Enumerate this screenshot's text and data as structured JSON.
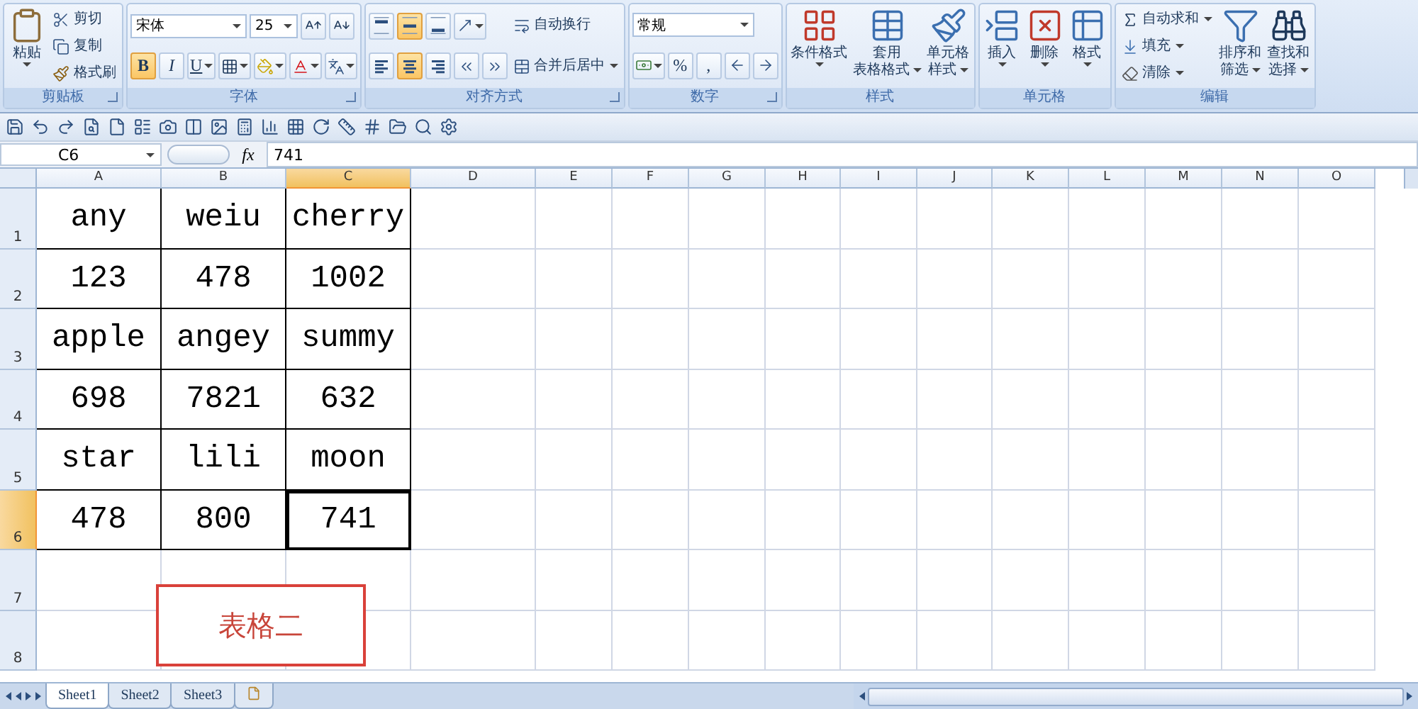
{
  "ribbon": {
    "groups": [
      {
        "title": "剪贴板",
        "launcher": true,
        "columns": [
          {
            "kind": "large",
            "button": {
              "kind": "paste",
              "lines": [
                "粘贴"
              ],
              "dropdown": true
            }
          },
          {
            "kind": "stack",
            "rows": [
              [
                {
                  "kind": "cut",
                  "label": "剪切"
                }
              ],
              [
                {
                  "kind": "copy",
                  "label": "复制"
                }
              ],
              [
                {
                  "kind": "painter",
                  "label": "格式刷"
                }
              ]
            ]
          }
        ]
      },
      {
        "title": "字体",
        "launcher": true,
        "columns": [
          {
            "kind": "stack",
            "rows": [
              [
                {
                  "kind": "font",
                  "value": "宋体"
                },
                {
                  "kind": "size",
                  "value": "25"
                },
                {
                  "kind": "grow"
                },
                {
                  "kind": "shrink"
                }
              ],
              [
                {
                  "kind": "bold",
                  "text": "B",
                  "selected": true
                },
                {
                  "kind": "italic",
                  "text": "I",
                  "selected": false
                },
                {
                  "kind": "underline",
                  "text": "U",
                  "selected": false,
                  "dropdown": true
                },
                {
                  "kind": "border",
                  "dropdown": true
                },
                {
                  "kind": "fill",
                  "dropdown": true
                },
                {
                  "kind": "fontcolor",
                  "dropdown": true
                },
                {
                  "kind": "phonetic",
                  "dropdown": true
                }
              ]
            ]
          }
        ]
      },
      {
        "title": "对齐方式",
        "launcher": true,
        "columns": [
          {
            "kind": "stack",
            "rows": [
              [
                {
                  "kind": "aligntop",
                  "selected": false
                },
                {
                  "kind": "alignmiddle",
                  "selected": true
                },
                {
                  "kind": "alignbottom",
                  "selected": false
                },
                {
                  "kind": "orient",
                  "dropdown": true
                }
              ],
              [
                {
                  "kind": "alignleft",
                  "selected": false
                },
                {
                  "kind": "aligncenter",
                  "selected": true
                },
                {
                  "kind": "alignright",
                  "selected": false
                },
                {
                  "kind": "outdent"
                },
                {
                  "kind": "indent"
                }
              ]
            ]
          },
          {
            "kind": "stack",
            "rows": [
              [
                {
                  "kind": "wrap",
                  "label": "自动换行"
                }
              ],
              [
                {
                  "kind": "merge",
                  "label": "合并后居中",
                  "dropdown": true
                }
              ]
            ]
          }
        ]
      },
      {
        "title": "数字",
        "launcher": true,
        "columns": [
          {
            "kind": "stack",
            "rows": [
              [
                {
                  "kind": "format",
                  "value": "常规"
                }
              ],
              [
                {
                  "kind": "currency",
                  "dropdown": true
                },
                {
                  "kind": "percent",
                  "text": "%"
                },
                {
                  "kind": "comma",
                  "text": ","
                },
                {
                  "kind": "decinc"
                },
                {
                  "kind": "decdec"
                }
              ]
            ]
          }
        ]
      },
      {
        "title": "样式",
        "launcher": false,
        "columns": [
          {
            "kind": "large",
            "button": {
              "kind": "conditional",
              "lines": [
                "条件格式"
              ],
              "dropdown": true
            }
          },
          {
            "kind": "large",
            "button": {
              "kind": "tablestyle",
              "lines": [
                "套用",
                "表格格式"
              ],
              "dropdown": true
            }
          },
          {
            "kind": "large",
            "button": {
              "kind": "cellstyle",
              "lines": [
                "单元格",
                "样式"
              ],
              "dropdown": true
            }
          }
        ]
      },
      {
        "title": "单元格",
        "launcher": false,
        "columns": [
          {
            "kind": "large",
            "button": {
              "kind": "insert",
              "lines": [
                "插入"
              ],
              "dropdown": true
            }
          },
          {
            "kind": "large",
            "button": {
              "kind": "delete",
              "lines": [
                "删除"
              ],
              "dropdown": true
            }
          },
          {
            "kind": "large",
            "button": {
              "kind": "cellformat",
              "lines": [
                "格式"
              ],
              "dropdown": true
            }
          }
        ]
      },
      {
        "title": "编辑",
        "launcher": false,
        "columns": [
          {
            "kind": "stack",
            "rows": [
              [
                {
                  "kind": "autosum",
                  "label": "自动求和",
                  "dropdown": true
                }
              ],
              [
                {
                  "kind": "filldown",
                  "label": "填充",
                  "dropdown": true
                }
              ],
              [
                {
                  "kind": "clear",
                  "label": "清除",
                  "dropdown": true
                }
              ]
            ]
          },
          {
            "kind": "large",
            "button": {
              "kind": "sort",
              "lines": [
                "排序和",
                "筛选"
              ],
              "dropdown": true
            }
          },
          {
            "kind": "large",
            "button": {
              "kind": "find",
              "lines": [
                "查找和",
                "选择"
              ],
              "dropdown": true
            }
          }
        ]
      }
    ]
  },
  "formula_bar": {
    "name_box": "C6",
    "function_label": "fx",
    "value": "741"
  },
  "grid": {
    "bordered": true,
    "columns": [
      {
        "label": "A",
        "selected": false
      },
      {
        "label": "B",
        "selected": false
      },
      {
        "label": "C",
        "selected": true
      },
      {
        "label": "D",
        "selected": false
      },
      {
        "label": "E",
        "selected": false
      },
      {
        "label": "F",
        "selected": false
      },
      {
        "label": "G",
        "selected": false
      },
      {
        "label": "H",
        "selected": false
      },
      {
        "label": "I",
        "selected": false
      },
      {
        "label": "J",
        "selected": false
      },
      {
        "label": "K",
        "selected": false
      },
      {
        "label": "L",
        "selected": false
      },
      {
        "label": "M",
        "selected": false
      },
      {
        "label": "N",
        "selected": false
      },
      {
        "label": "O",
        "selected": false
      }
    ],
    "rows": [
      {
        "label": "1",
        "selected": false,
        "cells": [
          "any",
          "weiu",
          "cherry"
        ]
      },
      {
        "label": "2",
        "selected": false,
        "cells": [
          "123",
          "478",
          "1002"
        ]
      },
      {
        "label": "3",
        "selected": false,
        "cells": [
          "apple",
          "angey",
          "summy"
        ]
      },
      {
        "label": "4",
        "selected": false,
        "cells": [
          "698",
          "7821",
          "632"
        ]
      },
      {
        "label": "5",
        "selected": false,
        "cells": [
          "star",
          "lili",
          "moon"
        ]
      },
      {
        "label": "6",
        "selected": true,
        "cells": [
          "478",
          "800",
          "741"
        ]
      },
      {
        "label": "7",
        "selected": false
      },
      {
        "label": "8",
        "selected": false
      }
    ],
    "text_box": {
      "text": "表格二"
    }
  },
  "sheet_tabs": [
    {
      "label": "Sheet1",
      "selected": true
    },
    {
      "label": "Sheet2",
      "selected": false
    },
    {
      "label": "Sheet3",
      "selected": false
    }
  ]
}
